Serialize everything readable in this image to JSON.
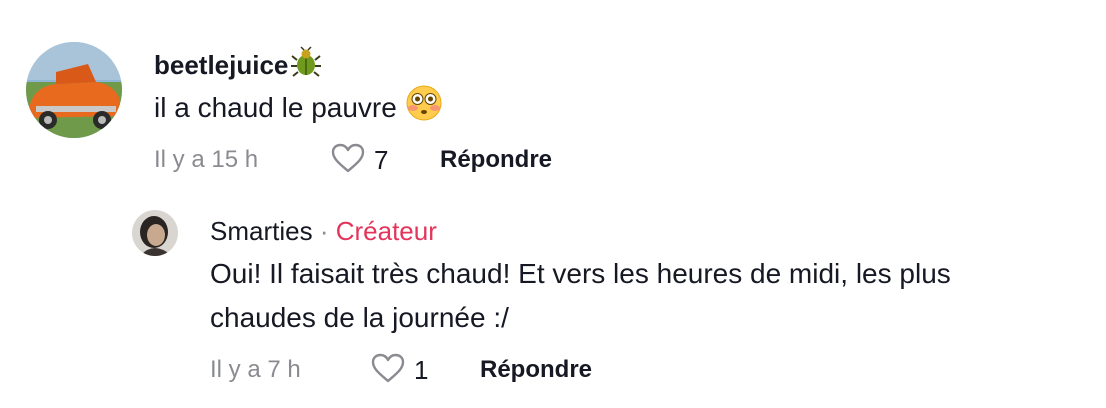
{
  "comments": [
    {
      "username": "beetlejuice",
      "badge_icon": "beetle-icon",
      "text": "il a chaud le pauvre",
      "emoji": "flushed-face-emoji",
      "time": "Il y a 15 h",
      "likes": "7",
      "reply_label": "Répondre"
    }
  ],
  "reply": {
    "username": "Smarties",
    "separator": "·",
    "role": "Créateur",
    "text_line1": "Oui! Il faisait très chaud! Et vers les heures de midi, les plus",
    "text_line2": "chaudes de la journée :/",
    "time": "Il y a 7 h",
    "likes": "1",
    "reply_label": "Répondre"
  },
  "colors": {
    "creator": "#e3355b",
    "meta": "#8a8b91",
    "text": "#161823"
  }
}
